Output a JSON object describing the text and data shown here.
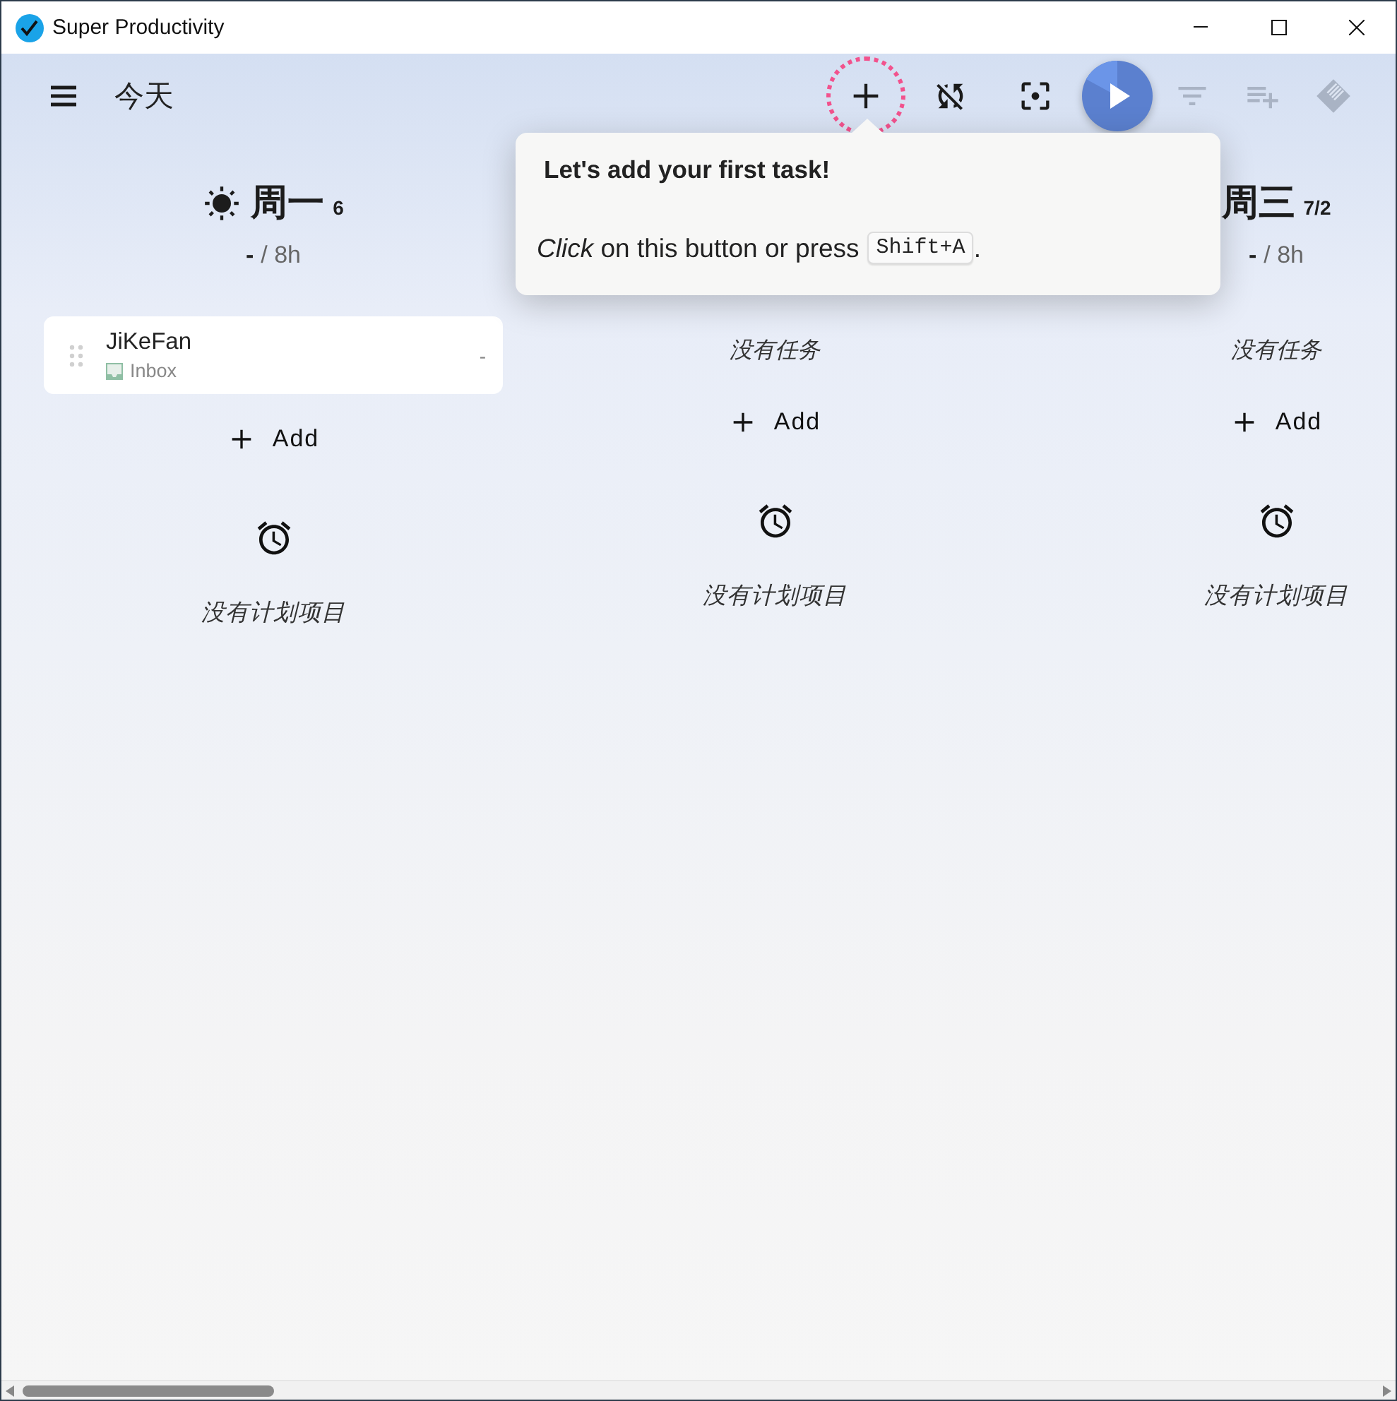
{
  "window": {
    "title": "Super Productivity"
  },
  "header": {
    "title": "今天"
  },
  "toolbar": [
    {
      "highlighted": true,
      "disabled": false
    },
    {
      "highlighted": false,
      "disabled": false
    },
    {
      "highlighted": false,
      "disabled": false
    },
    {
      "highlighted": false,
      "disabled": false
    },
    {
      "highlighted": false,
      "disabled": true
    },
    {
      "highlighted": false,
      "disabled": true
    },
    {
      "highlighted": false,
      "disabled": true
    }
  ],
  "tour_popup": {
    "title": "Let's add your first task!",
    "text": "*Click* on this button or press",
    "shortcut": "Shift+A",
    "end": "."
  },
  "columns": [
    {
      "today": true,
      "day": "周一",
      "count": "6",
      "estimate": "-",
      "capacity": "/ 8h",
      "tasks": [
        {
          "title": "JiKeFan",
          "project": "Inbox",
          "time": "-"
        }
      ],
      "add_label": "Add",
      "empty_schedule": "没有计划项目"
    },
    {
      "empty_tasks": "没有任务",
      "add_label": "Add",
      "empty_schedule": "没有计划项目"
    },
    {
      "today": false,
      "day": "周三",
      "count": "7/2",
      "estimate": "-",
      "capacity": "/ 8h",
      "empty_tasks": "没有任务",
      "add_label": "Add",
      "empty_schedule": "没有计划项目"
    }
  ]
}
